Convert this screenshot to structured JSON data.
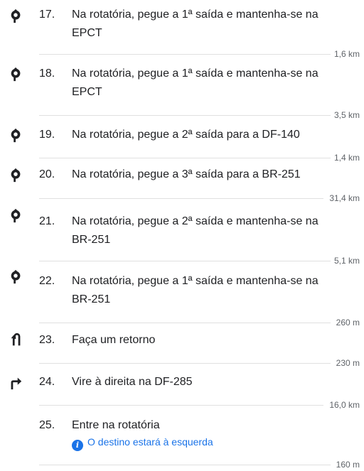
{
  "steps": [
    {
      "number": "17.",
      "text_line1": "Na rotatória, pegue a 1ª saída e mantenha-se na",
      "text_line2": "EPCT",
      "distance": "1,6 km",
      "icon": "roundabout-icon"
    },
    {
      "number": "18.",
      "text_line1": "Na rotatória, pegue a 1ª saída e mantenha-se na",
      "text_line2": "EPCT",
      "distance": "3,5 km",
      "icon": "roundabout-icon"
    },
    {
      "number": "19.",
      "text_line1": "Na rotatória, pegue a 2ª saída para a DF-140",
      "distance": "1,4 km",
      "icon": "roundabout-icon"
    },
    {
      "number": "20.",
      "text_line1": "Na rotatória, pegue a 3ª saída para a BR-251",
      "distance": "31,4 km",
      "icon": "roundabout-icon"
    },
    {
      "number": "21.",
      "text_line1": "Na rotatória, pegue a 2ª saída e mantenha-se na",
      "text_line2": "BR-251",
      "distance": "5,1 km",
      "icon": "roundabout-icon"
    },
    {
      "number": "22.",
      "text_line1": "Na rotatória, pegue a 1ª saída e mantenha-se na",
      "text_line2": "BR-251",
      "distance": "260 m",
      "icon": "roundabout-icon"
    },
    {
      "number": "23.",
      "text_line1": "Faça um retorno",
      "distance": "230 m",
      "icon": "u-turn-icon"
    },
    {
      "number": "24.",
      "text_line1": "Vire à direita na DF-285",
      "distance": "16,0 km",
      "icon": "turn-right-icon"
    },
    {
      "number": "25.",
      "text_line1": "Entre na rotatória",
      "note": "O destino estará à esquerda",
      "distance": "160 m"
    }
  ],
  "info_glyph": "i",
  "colors": {
    "text": "#202124",
    "muted": "#5f6368",
    "divider": "#e0e0e0",
    "link": "#1a73e8"
  }
}
